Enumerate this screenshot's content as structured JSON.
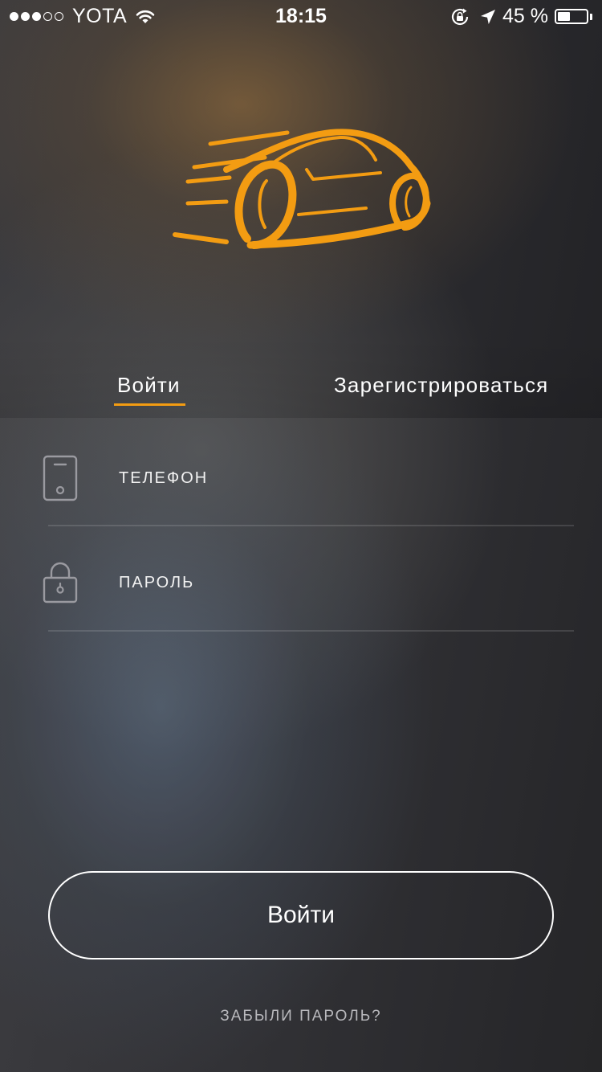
{
  "status_bar": {
    "carrier": "YOTA",
    "time": "18:15",
    "battery_percent": "45 %",
    "battery_level": 0.45,
    "signal_strength": 3,
    "signal_max": 5,
    "icons": [
      "wifi-icon",
      "rotation-lock-icon",
      "location-arrow-icon",
      "battery-icon"
    ]
  },
  "logo": {
    "icon": "sports-car-icon",
    "color": "#f39c12"
  },
  "tabs": [
    {
      "label": "Войти",
      "active": true
    },
    {
      "label": "Зарегистрироваться",
      "active": false
    }
  ],
  "form": {
    "phone": {
      "placeholder": "ТЕЛЕФОН",
      "value": "",
      "icon": "phone-icon"
    },
    "password": {
      "placeholder": "ПАРОЛЬ",
      "value": "",
      "icon": "lock-icon"
    }
  },
  "login_button": {
    "label": "Войти"
  },
  "forgot_password": {
    "label": "ЗАБЫЛИ ПАРОЛЬ?"
  },
  "colors": {
    "accent": "#f39c12",
    "text": "#ffffff",
    "muted": "#b9b9bd"
  }
}
